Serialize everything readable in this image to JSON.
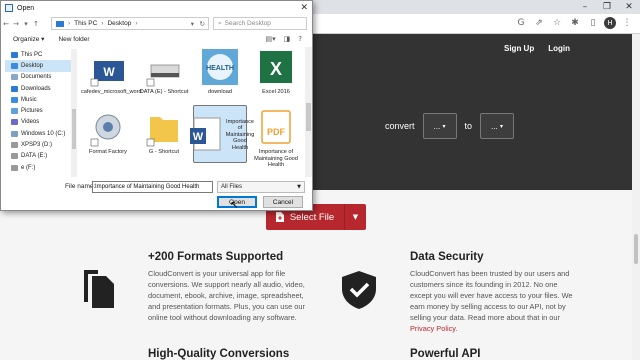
{
  "browser": {
    "window_controls": [
      "–",
      "❐",
      "✕"
    ],
    "profile_initial": "H"
  },
  "site": {
    "nav": {
      "sign_up": "Sign Up",
      "login": "Login"
    },
    "convert_label": "convert",
    "to_label": "to",
    "from_select": "...",
    "to_select": "...",
    "select_file": "Select File",
    "features": [
      {
        "title": "+200 Formats Supported",
        "lines": [
          "CloudConvert is your universal app for file",
          "conversions. We support nearly all audio, video,",
          "document, ebook, archive, image, spreadsheet,",
          "and presentation formats. Plus, you can use our",
          "online tool without downloading any software."
        ]
      },
      {
        "title": "Data Security",
        "lines": [
          "CloudConvert has been trusted by our users and",
          "customers since its founding in 2012. No one",
          "except you will ever have access to your files. We",
          "earn money by selling access to our API, not by",
          "selling your data. Read more about that in our"
        ],
        "link": "Privacy Policy",
        "link_suffix": "."
      },
      {
        "title": "High-Quality Conversions"
      },
      {
        "title": "Powerful API"
      }
    ]
  },
  "dialog": {
    "title": "Open",
    "breadcrumb": [
      "This PC",
      "Desktop"
    ],
    "search_placeholder": "Search Desktop",
    "organize": "Organize ▾",
    "new_folder": "New folder",
    "nav_items": [
      "This PC",
      "Desktop",
      "Documents",
      "Downloads",
      "Music",
      "Pictures",
      "Videos",
      "Windows 10 (C:)",
      "XPSP3 (D:)",
      "DATA (E:)",
      "e (F:)"
    ],
    "active_nav": "Desktop",
    "files": [
      {
        "name": "cafedev_microsoft_word",
        "type": "word"
      },
      {
        "name": "DATA (E) - Shortcut",
        "type": "drive"
      },
      {
        "name": "download",
        "type": "image"
      },
      {
        "name": "Excel 2016",
        "type": "excel"
      },
      {
        "name": "Format Factory",
        "type": "app"
      },
      {
        "name": "G - Shortcut",
        "type": "folder"
      },
      {
        "name": "Importance of Maintaining Good Health",
        "type": "word-doc",
        "selected": true
      },
      {
        "name": "Importance of Maintaining Good Health",
        "type": "pdf"
      }
    ],
    "file_name_label": "File name:",
    "file_name_value": "Importance of Maintaining Good Health",
    "file_type": "All Files",
    "open_button": "Open",
    "cancel_button": "Cancel"
  },
  "colors": {
    "accent": "#b7282e",
    "hero_bg": "#333333"
  }
}
